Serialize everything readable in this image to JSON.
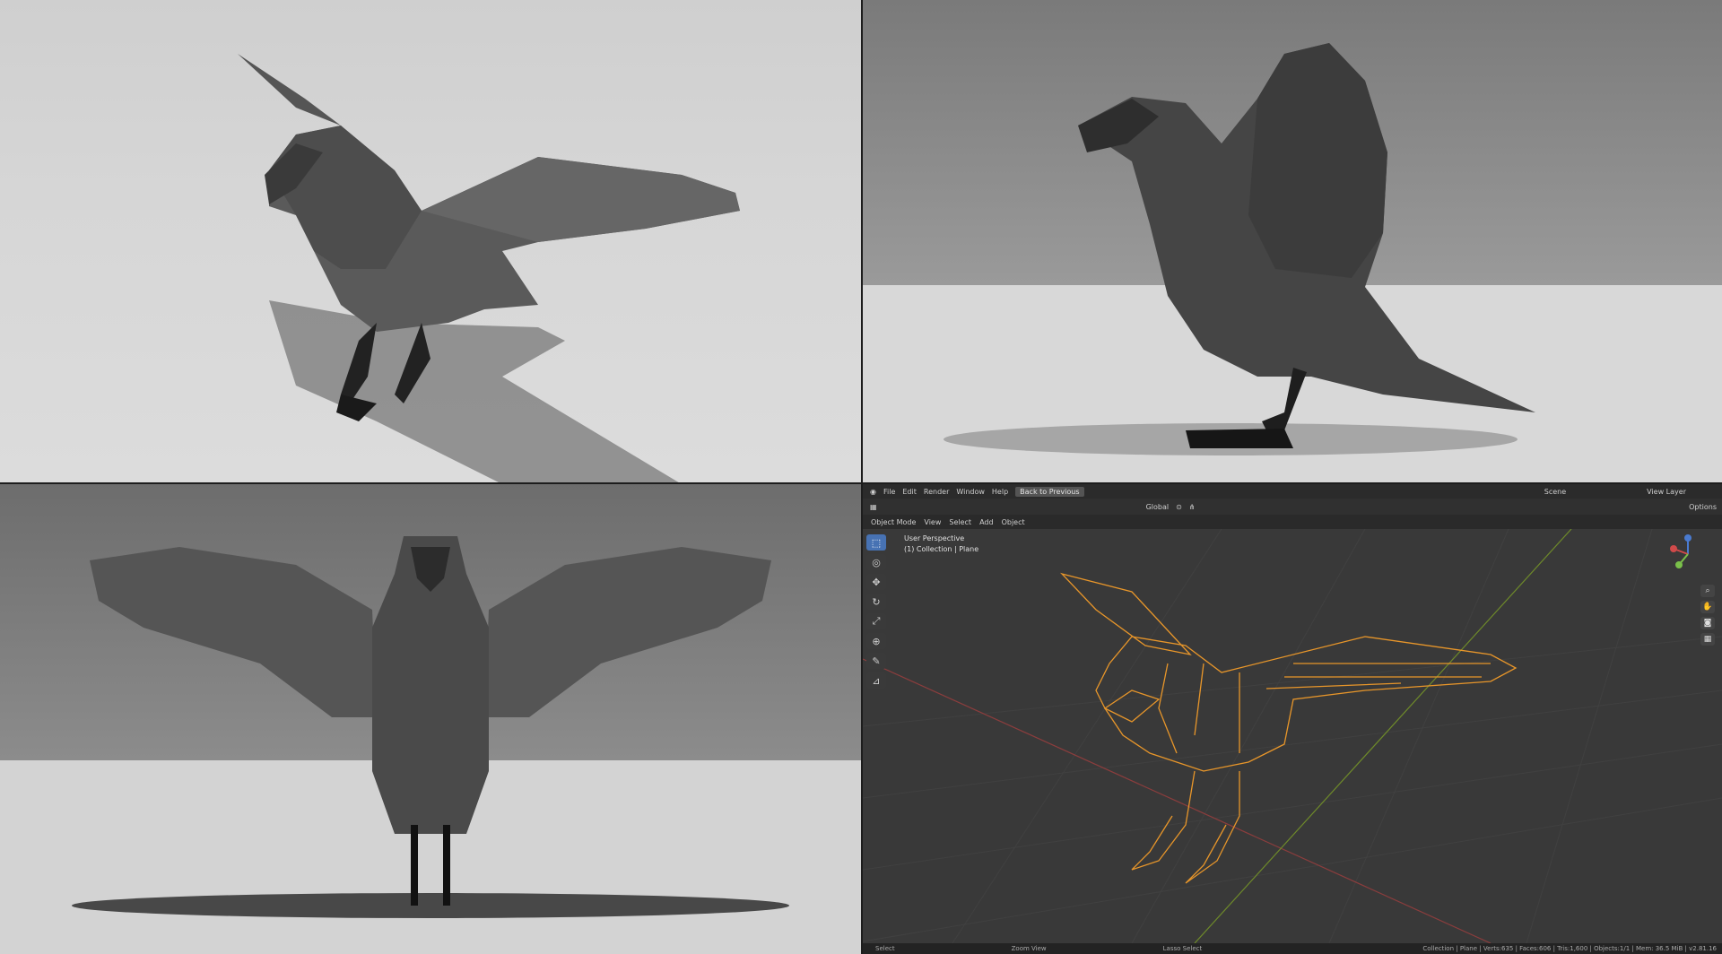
{
  "menu": {
    "items": [
      "File",
      "Edit",
      "Render",
      "Window",
      "Help"
    ],
    "back_button": "Back to Previous",
    "scene_label": "Scene",
    "view_layer_label": "View Layer"
  },
  "header": {
    "transform_orientation": "Global",
    "options_label": "Options"
  },
  "viewport_header": {
    "mode": "Object Mode",
    "view": "View",
    "select": "Select",
    "add": "Add",
    "object": "Object"
  },
  "viewport": {
    "perspective": "User Perspective",
    "collection": "(1) Collection | Plane"
  },
  "status": {
    "select": "Select",
    "zoom": "Zoom View",
    "lasso": "Lasso Select",
    "stats": "Collection | Plane | Verts:635 | Faces:606 | Tris:1,600 | Objects:1/1 | Mem: 36.5 MiB | v2.81.16"
  },
  "colors": {
    "selection_outline": "#e8962a",
    "active_tool": "#4772b3",
    "viewport_bg": "#393939"
  },
  "icons": [
    "blender-logo-icon",
    "select-box-icon",
    "cursor-icon",
    "move-icon",
    "rotate-icon",
    "scale-icon",
    "transform-icon",
    "annotate-icon",
    "measure-icon",
    "zoom-icon",
    "hand-icon",
    "camera-icon",
    "grid-icon",
    "navigation-gizmo-icon"
  ]
}
